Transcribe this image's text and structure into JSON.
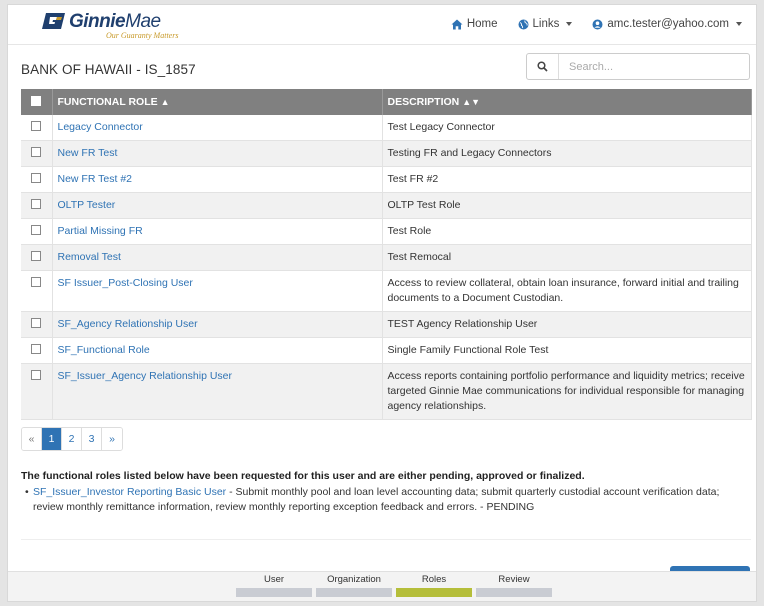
{
  "header": {
    "logo_name": "Ginnie",
    "logo_name2": "Mae",
    "logo_tagline": "Our Guaranty Matters",
    "nav": {
      "home": "Home",
      "links": "Links",
      "user": "amc.tester@yahoo.com"
    }
  },
  "page_title": "BANK OF HAWAII - IS_1857",
  "search": {
    "placeholder": "Search..."
  },
  "table": {
    "headers": {
      "role": "FUNCTIONAL ROLE",
      "role_sort": "▲",
      "description": "DESCRIPTION",
      "description_sort": "▲▼"
    },
    "rows": [
      {
        "role": "Legacy Connector",
        "description": "Test Legacy Connector"
      },
      {
        "role": "New FR Test",
        "description": "Testing FR and Legacy Connectors"
      },
      {
        "role": "New FR Test #2",
        "description": "Test FR #2"
      },
      {
        "role": "OLTP Tester",
        "description": "OLTP Test Role"
      },
      {
        "role": "Partial Missing FR",
        "description": "Test Role"
      },
      {
        "role": "Removal Test",
        "description": "Test Remocal"
      },
      {
        "role": "SF Issuer_Post-Closing User",
        "description": "Access to review collateral, obtain loan insurance, forward initial and trailing documents to a Document Custodian."
      },
      {
        "role": "SF_Agency Relationship User",
        "description": "TEST Agency Relationship User"
      },
      {
        "role": "SF_Functional Role",
        "description": "Single Family Functional Role Test"
      },
      {
        "role": "SF_Issuer_Agency Relationship User",
        "description": "Access reports containing portfolio performance and liquidity metrics; receive targeted Ginnie Mae communications for individual responsible for managing agency relationships."
      }
    ]
  },
  "pagination": {
    "prev": "«",
    "pages": [
      "1",
      "2",
      "3"
    ],
    "next": "»",
    "active": "1"
  },
  "requested": {
    "heading": "The functional roles listed below have been requested for this user and are either pending, approved or finalized.",
    "items": [
      {
        "role": "SF_Issuer_Investor Reporting Basic User",
        "text": " - Submit monthly pool and loan level accounting data; submit quarterly custodial account verification data; review monthly remittance information, review monthly reporting exception feedback and errors. - PENDING"
      }
    ]
  },
  "wizard": {
    "steps": [
      "User",
      "Organization",
      "Roles",
      "Review"
    ],
    "active_step": "Roles"
  },
  "colors": {
    "accent": "#2f73b4",
    "header_gray": "#808080",
    "step_active": "#b5be3a",
    "step_idle": "#c9ccd3",
    "brand_navy": "#1f3f6e",
    "brand_gold": "#c89a2a"
  },
  "icons": {
    "home": "home-icon",
    "links": "globe-icon",
    "user": "user-circle-icon",
    "search": "search-icon"
  }
}
